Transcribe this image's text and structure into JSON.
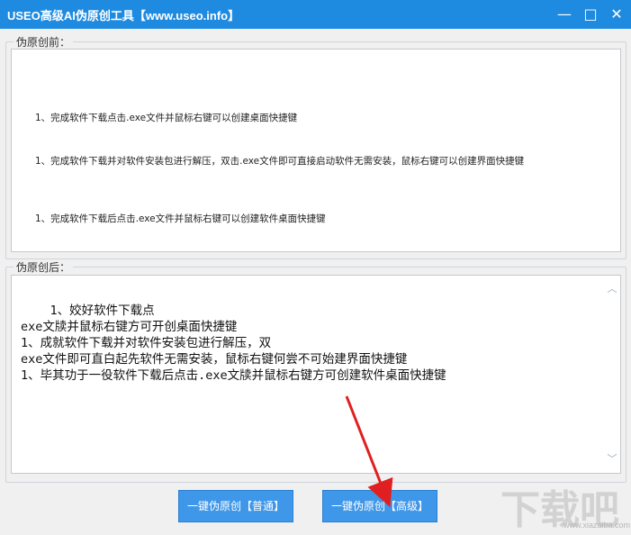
{
  "window": {
    "title": "USEO高级AI伪原创工具【www.useo.info】",
    "controls": [
      "—",
      "□",
      "✕"
    ]
  },
  "source_group": {
    "label": "伪原创前：",
    "lines": [
      "1、完成软件下载点击.exe文件并鼠标右键可以创建桌面快捷键",
      "1、完成软件下载并对软件安装包进行解压，双击.exe文件即可直接启动软件无需安装，鼠标右键可以创建界面快捷键",
      "1、完成软件下载后点击.exe文件并鼠标右键可以创建软件桌面快捷键"
    ]
  },
  "result_group": {
    "label": "伪原创后：",
    "text": "    1、姣好软件下载点\nexe文牍并鼠标右键方可开创桌面快捷键\n1、成就软件下载并对软件安装包进行解压，双\nexe文件即可直白起先软件无需安装，鼠标右键何尝不可始建界面快捷键\n1、毕其功于一役软件下载后点击.exe文牍并鼠标右键方可创建软件桌面快捷键"
  },
  "buttons": {
    "normal": "一键伪原创【普通】",
    "advanced": "一键伪原创【高级】"
  },
  "watermark": {
    "text": "下载吧",
    "url": "www.xiazaiba.com"
  },
  "colors": {
    "titlebar": "#1f8be0",
    "button": "#3f97ea",
    "arrow": "#e02020"
  }
}
